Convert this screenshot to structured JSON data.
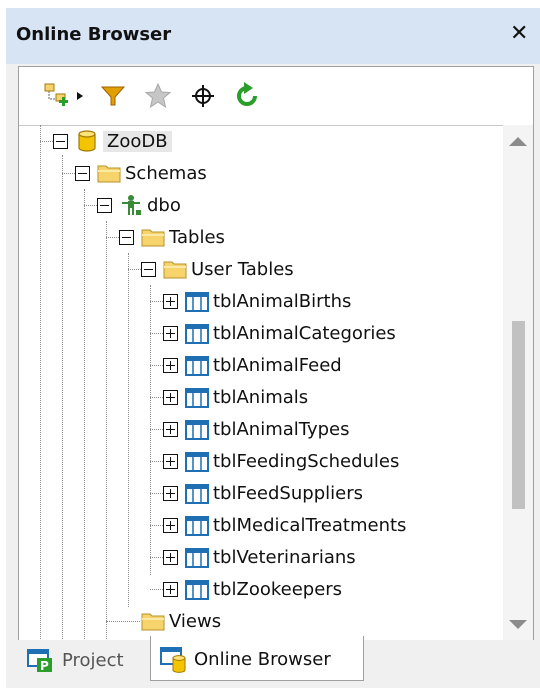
{
  "panel": {
    "title": "Online Browser",
    "close_glyph": "✕",
    "close_icon": "close-icon"
  },
  "toolbar": {
    "buttons": [
      {
        "icon": "add-objects-icon",
        "has_dropdown": true
      },
      {
        "icon": "filter-icon"
      },
      {
        "icon": "favorites-star-icon",
        "disabled": true
      },
      {
        "icon": "locate-object-icon"
      },
      {
        "icon": "refresh-icon"
      }
    ]
  },
  "tree": {
    "root": {
      "label": "ZooDB",
      "icon": "database-icon",
      "selected": true
    },
    "schemas": {
      "label": "Schemas",
      "icon": "folder-icon"
    },
    "dbo": {
      "label": "dbo",
      "icon": "schema-user-icon"
    },
    "tables": {
      "label": "Tables",
      "icon": "folder-icon"
    },
    "user_tables": {
      "label": "User Tables",
      "icon": "folder-icon"
    },
    "table_items": [
      {
        "label": "tblAnimalBirths"
      },
      {
        "label": "tblAnimalCategories"
      },
      {
        "label": "tblAnimalFeed"
      },
      {
        "label": "tblAnimals"
      },
      {
        "label": "tblAnimalTypes"
      },
      {
        "label": "tblFeedingSchedules"
      },
      {
        "label": "tblFeedSuppliers"
      },
      {
        "label": "tblMedicalTreatments"
      },
      {
        "label": "tblVeterinarians"
      },
      {
        "label": "tblZookeepers"
      }
    ],
    "views": {
      "label": "Views",
      "icon": "folder-icon"
    }
  },
  "tabs": [
    {
      "label": "Project",
      "icon": "project-icon",
      "active": false
    },
    {
      "label": "Online Browser",
      "icon": "online-browser-icon",
      "active": true
    }
  ],
  "colors": {
    "title_bar": "#d6e4f3",
    "folder": "#f7d36b",
    "database": "#f5c400",
    "table_icon": "#1f6fb5",
    "filter": "#e0a000",
    "refresh": "#2a9d2a"
  }
}
